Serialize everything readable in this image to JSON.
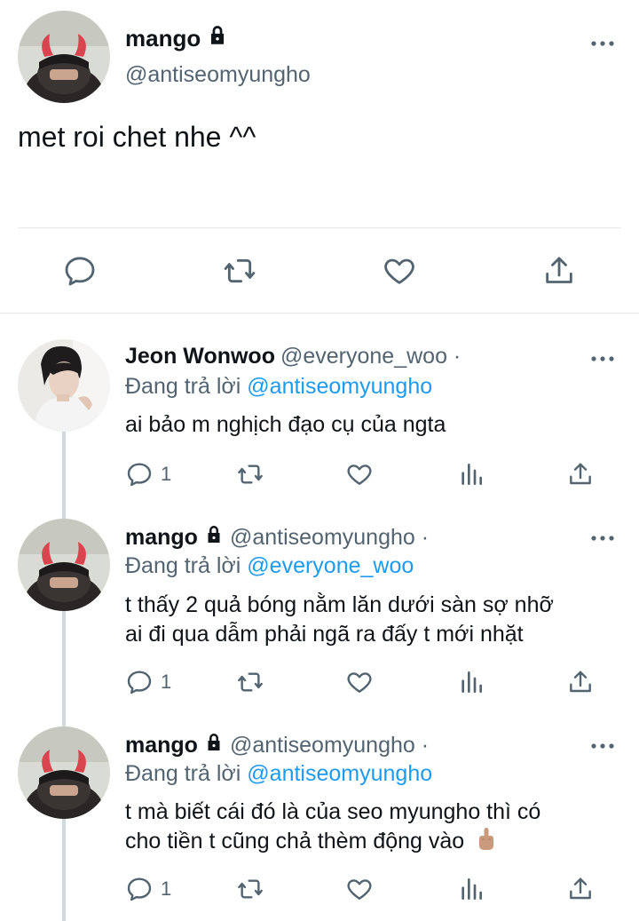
{
  "main_tweet": {
    "author_name": "mango",
    "author_handle": "@antiseomyungho",
    "text": "met roi chet nhe ^^",
    "locked": true,
    "actions": [
      "reply-icon",
      "retweet-icon",
      "like-icon",
      "share-icon"
    ]
  },
  "replies": [
    {
      "author_name": "Jeon Wonwoo",
      "author_handle": "@everyone_woo ·",
      "replying_prefix": "Đang trả lời",
      "replying_to": "@antiseomyungho",
      "lines": [
        "ai bảo m nghịch đạo cụ của ngta"
      ],
      "reply_count": "1",
      "locked": false
    },
    {
      "author_name": "mango",
      "author_handle": "@antiseomyungho ·",
      "replying_prefix": "Đang trả lời",
      "replying_to": "@everyone_woo",
      "lines": [
        "t thấy 2 quả bóng nằm lăn dưới sàn sợ nhỡ",
        "ai đi qua dẫm phải ngã ra đấy t mới nhặt"
      ],
      "reply_count": "1",
      "locked": true
    },
    {
      "author_name": "mango",
      "author_handle": "@antiseomyungho ·",
      "replying_prefix": "Đang trả lời",
      "replying_to": "@antiseomyungho",
      "lines": [
        "t mà biết cái đó là của seo myungho thì có",
        "cho tiền t cũng chả thèm động vào"
      ],
      "reply_count": "1",
      "locked": true
    }
  ],
  "colors": {
    "text": "#0f1419",
    "secondary": "#536471",
    "link": "#1d9bf0",
    "divider": "#e6e9eb",
    "thread_line": "#cfd9de"
  }
}
